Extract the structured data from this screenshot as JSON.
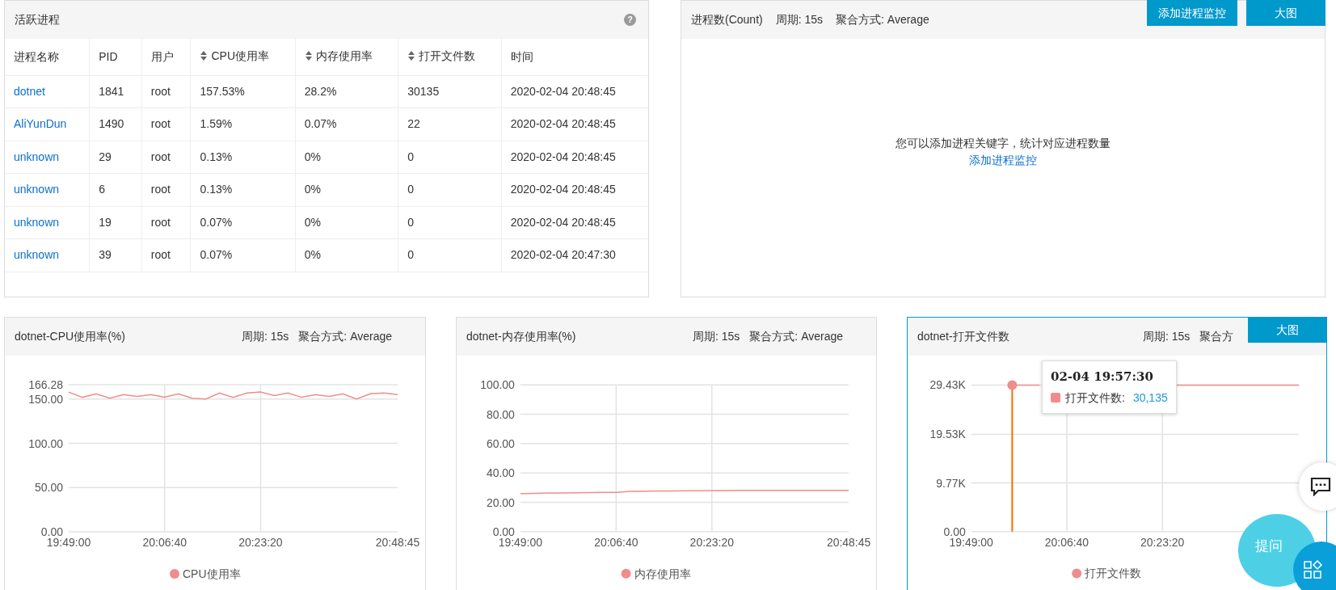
{
  "process_panel": {
    "title": "活跃进程",
    "help": "?",
    "columns": [
      {
        "label": "进程名称",
        "sortable": false
      },
      {
        "label": "PID",
        "sortable": false
      },
      {
        "label": "用户",
        "sortable": false
      },
      {
        "label": "CPU使用率",
        "sortable": true
      },
      {
        "label": "内存使用率",
        "sortable": true
      },
      {
        "label": "打开文件数",
        "sortable": true
      },
      {
        "label": "时间",
        "sortable": false
      }
    ],
    "rows": [
      {
        "name": "dotnet",
        "pid": "1841",
        "user": "root",
        "cpu": "157.53%",
        "mem": "28.2%",
        "files": "30135",
        "time": "2020-02-04 20:48:45"
      },
      {
        "name": "AliYunDun",
        "pid": "1490",
        "user": "root",
        "cpu": "1.59%",
        "mem": "0.07%",
        "files": "22",
        "time": "2020-02-04 20:48:45"
      },
      {
        "name": "unknown",
        "pid": "29",
        "user": "root",
        "cpu": "0.13%",
        "mem": "0%",
        "files": "0",
        "time": "2020-02-04 20:48:45"
      },
      {
        "name": "unknown",
        "pid": "6",
        "user": "root",
        "cpu": "0.13%",
        "mem": "0%",
        "files": "0",
        "time": "2020-02-04 20:48:45"
      },
      {
        "name": "unknown",
        "pid": "19",
        "user": "root",
        "cpu": "0.07%",
        "mem": "0%",
        "files": "0",
        "time": "2020-02-04 20:48:45"
      },
      {
        "name": "unknown",
        "pid": "39",
        "user": "root",
        "cpu": "0.07%",
        "mem": "0%",
        "files": "0",
        "time": "2020-02-04 20:47:30"
      }
    ]
  },
  "count_panel": {
    "title": "进程数(Count)",
    "period": "周期: 15s",
    "aggregation": "聚合方式: Average",
    "buttons": [
      "添加进程监控",
      "大图"
    ],
    "empty_message": "您可以添加进程关键字，统计对应进程数量",
    "empty_link": "添加进程监控"
  },
  "chart_panels": [
    {
      "title": "dotnet-CPU使用率(%)",
      "period": "周期: 15s",
      "aggregation": "聚合方式: Average",
      "highlighted": false,
      "chart_data": {
        "type": "line",
        "categories": [
          "19:49:00",
          null,
          null,
          null,
          null,
          null,
          null,
          "20:06:40",
          null,
          null,
          null,
          null,
          null,
          null,
          "20:23:20",
          null,
          null,
          null,
          null,
          null,
          null,
          null,
          null,
          null,
          "20:48:45"
        ],
        "series": [
          {
            "name": "CPU使用率",
            "color": "#f08c8c",
            "values": [
              158,
              152,
              156,
              151,
              155,
              153,
              155,
              152,
              156,
              151,
              150,
              157,
              152,
              157,
              158,
              154,
              157,
              152,
              155,
              153,
              156,
              150,
              156,
              157,
              155
            ]
          }
        ],
        "ylim": [
          0,
          166.28
        ],
        "grid": true,
        "yticks": [
          {
            "value": 0,
            "label": "0.00"
          },
          {
            "value": 50,
            "label": "50.00"
          },
          {
            "value": 100,
            "label": "100.00"
          },
          {
            "value": 150,
            "label": "150.00"
          },
          {
            "value": 166.28,
            "label": "166.28"
          }
        ]
      }
    },
    {
      "title": "dotnet-内存使用率(%)",
      "period": "周期: 15s",
      "aggregation": "聚合方式: Average",
      "highlighted": false,
      "chart_data": {
        "type": "line",
        "categories": [
          "19:49:00",
          null,
          null,
          null,
          null,
          null,
          null,
          "20:06:40",
          null,
          null,
          null,
          null,
          null,
          null,
          "20:23:20",
          null,
          null,
          null,
          null,
          null,
          null,
          null,
          null,
          null,
          "20:48:45"
        ],
        "series": [
          {
            "name": "内存使用率",
            "color": "#f08c8c",
            "values": [
              26,
              26.1,
              26.3,
              26.4,
              26.5,
              26.6,
              26.7,
              26.8,
              27.4,
              27.6,
              27.7,
              27.7,
              27.8,
              27.9,
              28,
              28,
              28.1,
              28.1,
              28.1,
              28.2,
              28.2,
              28.2,
              28.2,
              28.2,
              28.2
            ]
          }
        ],
        "ylim": [
          0,
          100
        ],
        "grid": true,
        "yticks": [
          {
            "value": 0,
            "label": "0.00"
          },
          {
            "value": 20,
            "label": "20.00"
          },
          {
            "value": 40,
            "label": "40.00"
          },
          {
            "value": 60,
            "label": "60.00"
          },
          {
            "value": 80,
            "label": "80.00"
          },
          {
            "value": 100,
            "label": "100.00"
          }
        ]
      }
    },
    {
      "title": "dotnet-打开文件数",
      "period": "周期: 15s",
      "aggregation": "聚合方",
      "highlighted": true,
      "buttons": [
        "大图"
      ],
      "tooltip": {
        "title": "02-04 19:57:30",
        "label": "打开文件数:",
        "value": "30,135"
      },
      "chart_data": {
        "type": "line",
        "categories": [
          "19:49:00",
          null,
          null,
          null,
          null,
          null,
          null,
          "20:06:40",
          null,
          null,
          null,
          null,
          null,
          null,
          "20:23:20",
          null,
          null,
          null,
          null,
          null,
          null,
          null,
          null,
          null,
          null
        ],
        "series": [
          {
            "name": "打开文件数",
            "color": "#f08c8c",
            "values": [
              null,
              null,
              null,
              29.43,
              29.43,
              29.43,
              null,
              null,
              null,
              null,
              null,
              null,
              null,
              null,
              null,
              29.43,
              29.43,
              29.43,
              29.43,
              29.43,
              29.43,
              29.43,
              29.43,
              29.43,
              29.43
            ]
          }
        ],
        "grid": true,
        "ylim": [
          0,
          29.43
        ],
        "yticks": [
          {
            "value": 0,
            "label": "0.00"
          },
          {
            "value": 9.77,
            "label": "9.77K"
          },
          {
            "value": 19.53,
            "label": "19.53K"
          },
          {
            "value": 29.43,
            "label": "29.43K"
          }
        ]
      }
    }
  ],
  "floating": {
    "ask": "提问"
  }
}
